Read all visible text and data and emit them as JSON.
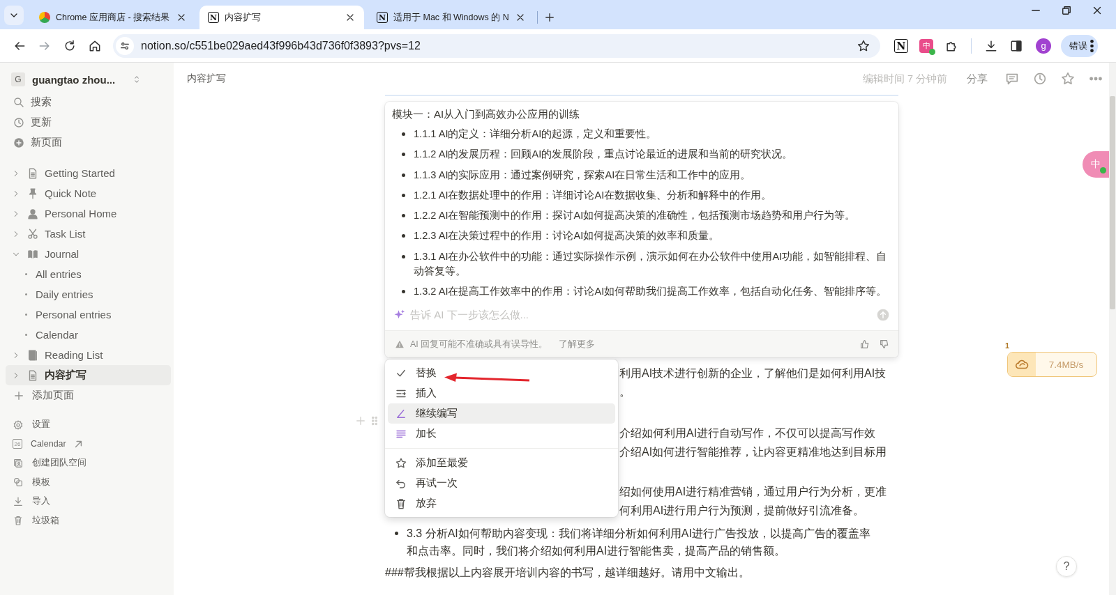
{
  "browser": {
    "tabs": [
      {
        "title": "Chrome 应用商店 - 搜索结果",
        "selected": false
      },
      {
        "title": "内容扩写",
        "logo": "N",
        "selected": true
      },
      {
        "title": "适用于 Mac 和 Windows 的 N",
        "logo": "N",
        "selected": false
      }
    ],
    "url": "notion.so/c551be029aed43f996b43d736f0f3893?pvs=12",
    "extensions": [
      {
        "kind": "notion",
        "glyph": "N"
      },
      {
        "kind": "translate",
        "glyph": "中"
      },
      {
        "kind": "puzzle"
      }
    ],
    "profile_initial": "g",
    "error_button": "错误"
  },
  "sidebar": {
    "workspace_initial": "G",
    "workspace": "guangtao zhou...",
    "nav": [
      {
        "label": "搜索"
      },
      {
        "label": "更新"
      },
      {
        "label": "新页面"
      }
    ],
    "pages": [
      {
        "label": "Getting Started",
        "expanded": false,
        "selected": false
      },
      {
        "label": "Quick Note",
        "expanded": false,
        "selected": false
      },
      {
        "label": "Personal Home",
        "expanded": false,
        "selected": false
      },
      {
        "label": "Task List",
        "expanded": false,
        "selected": false
      },
      {
        "label": "Journal",
        "expanded": true,
        "selected": false,
        "children": [
          {
            "label": "All entries",
            "selected": false
          },
          {
            "label": "Daily entries",
            "selected": false
          },
          {
            "label": "Personal entries",
            "selected": false
          },
          {
            "label": "Calendar",
            "selected": false
          }
        ]
      },
      {
        "label": "Reading List",
        "expanded": false,
        "selected": false
      },
      {
        "label": "内容扩写",
        "expanded": false,
        "selected": true
      }
    ],
    "add_page": "添加页面",
    "footer": [
      {
        "label": "设置"
      },
      {
        "label": "Calendar",
        "date": "26",
        "external": true
      },
      {
        "label": "创建团队空间"
      },
      {
        "label": "模板"
      },
      {
        "label": "导入"
      },
      {
        "label": "垃圾箱"
      }
    ]
  },
  "topbar": {
    "breadcrumb": "内容扩写",
    "edited": "编辑时间 7 分钟前",
    "share": "分享"
  },
  "ai_panel": {
    "heading": "模块一：AI从入门到高效办公应用的训练",
    "items": [
      "1.1.1 AI的定义：详细分析AI的起源，定义和重要性。",
      "1.1.2 AI的发展历程：回顾AI的发展阶段，重点讨论最近的进展和当前的研究状况。",
      "1.1.3 AI的实际应用：通过案例研究，探索AI在日常生活和工作中的应用。",
      "1.2.1 AI在数据处理中的作用：详细讨论AI在数据收集、分析和解释中的作用。",
      "1.2.2 AI在智能预测中的作用：探讨AI如何提高决策的准确性，包括预测市场趋势和用户行为等。",
      "1.2.3 AI在决策过程中的作用：讨论AI如何提高决策的效率和质量。",
      "1.3.1 AI在办公软件中的功能：通过实际操作示例，演示如何在办公软件中使用AI功能，如智能排程、自动答复等。",
      "1.3.2 AI在提高工作效率中的作用：讨论AI如何帮助我们提高工作效率，包括自动化任务、智能排序等。"
    ],
    "placeholder": "告诉 AI 下一步该怎么做...",
    "disclaimer": "AI 回复可能不准确或具有误导性。",
    "learn_more": "了解更多"
  },
  "menu": {
    "groups": [
      [
        {
          "label": "替换",
          "selected": false
        },
        {
          "label": "插入",
          "selected": false
        },
        {
          "label": "继续编写",
          "selected": true
        },
        {
          "label": "加长",
          "selected": false
        }
      ],
      [
        {
          "label": "添加至最爱",
          "selected": false
        },
        {
          "label": "再试一次",
          "selected": false
        },
        {
          "label": "放弃",
          "selected": false
        }
      ]
    ]
  },
  "document": {
    "blocks": [
      {
        "kind": "covered",
        "lines": [
          "利用AI技术进行创新的企业，了解他们是如何利用AI技",
          "。"
        ]
      },
      {
        "kind": "covered",
        "lines": [
          "介绍如何利用AI进行自动写作，不仅可以提高写作效",
          "介绍AI如何进行智能推荐，让内容更精准地达到目标用"
        ]
      },
      {
        "kind": "covered",
        "lines": [
          "绍如何使用AI进行精准营销，通过用户行为分析，更准",
          "何利用AI进行用户行为预测，提前做好引流准备。"
        ]
      },
      {
        "kind": "bullet",
        "text": "3.3 分析AI如何帮助内容变现：我们将详细分析如何利用AI进行广告投放，以提高广告的覆盖率和点击率。同时，我们将介绍如何利用AI进行智能售卖，提高产品的销售额。"
      },
      {
        "kind": "paragraph",
        "text": "###帮我根据以上内容展开培训内容的书写，越详细越好。请用中文输出。"
      }
    ]
  },
  "download_widget": {
    "count": "1",
    "speed": "7.4MB/s"
  },
  "translate_button": {
    "glyph": "中"
  },
  "help_button": "?"
}
